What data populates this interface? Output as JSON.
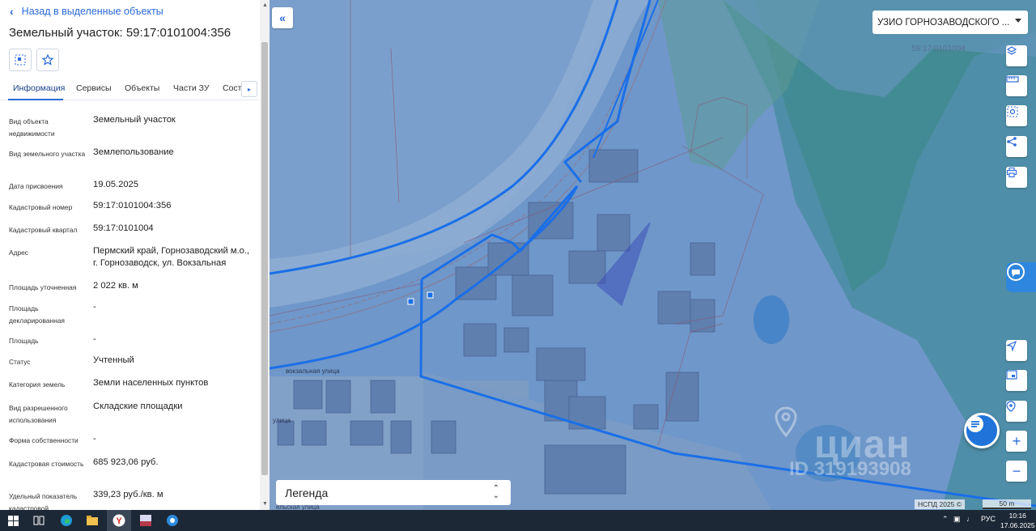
{
  "panel": {
    "back_label": "Назад в выделенные объекты",
    "title": "Земельный участок: 59:17:0101004:356",
    "tabs": [
      "Информация",
      "Сервисы",
      "Объекты",
      "Части ЗУ",
      "Соста"
    ],
    "rows": [
      {
        "label": "Вид объекта недвижимости",
        "value": "Земельный участок"
      },
      {
        "label": "Вид земельного участка",
        "value": "Землепользование"
      },
      {
        "label": "Дата присвоения",
        "value": "19.05.2025"
      },
      {
        "label": "Кадастровый номер",
        "value": "59:17:0101004:356"
      },
      {
        "label": "Кадастровый квартал",
        "value": "59:17:0101004"
      },
      {
        "label": "Адрес",
        "value": "Пермский край, Горнозаводский м.о., г. Горнозаводск, ул. Вокзальная"
      },
      {
        "label": "Площадь уточненная",
        "value": "2 022 кв. м"
      },
      {
        "label": "Площадь декларированная",
        "value": "-"
      },
      {
        "label": "Площадь",
        "value": "-"
      },
      {
        "label": "Статус",
        "value": "Учтенный"
      },
      {
        "label": "Категория земель",
        "value": "Земли населенных пунктов"
      },
      {
        "label": "Вид разрешенного использования",
        "value": "Складские площадки"
      },
      {
        "label": "Форма собственности",
        "value": "-"
      },
      {
        "label": "Кадастровая стоимость",
        "value": "685 923,06 руб."
      },
      {
        "label": "Удельный показатель кадастровой",
        "value": "339,23 руб./кв. м"
      }
    ]
  },
  "map": {
    "layer_select": "УЗИО ГОРНОЗАВОДСКОГО ...",
    "quarter_label": "59:17:0101004",
    "legend_label": "Легенда",
    "street_1": "вокзальная улица",
    "street_2": "улица",
    "street_3": "ельская улица",
    "attribution": "НСПД 2025 ©",
    "scale_label": "50 m",
    "watermark_brand": "циан",
    "watermark_id": "ID 319193908",
    "parcel_color": "#3d4fb8",
    "boundary_color": "#1a6fe8"
  },
  "taskbar": {
    "lang": "РУС",
    "time": "10:16",
    "date": "17.06.2025"
  }
}
